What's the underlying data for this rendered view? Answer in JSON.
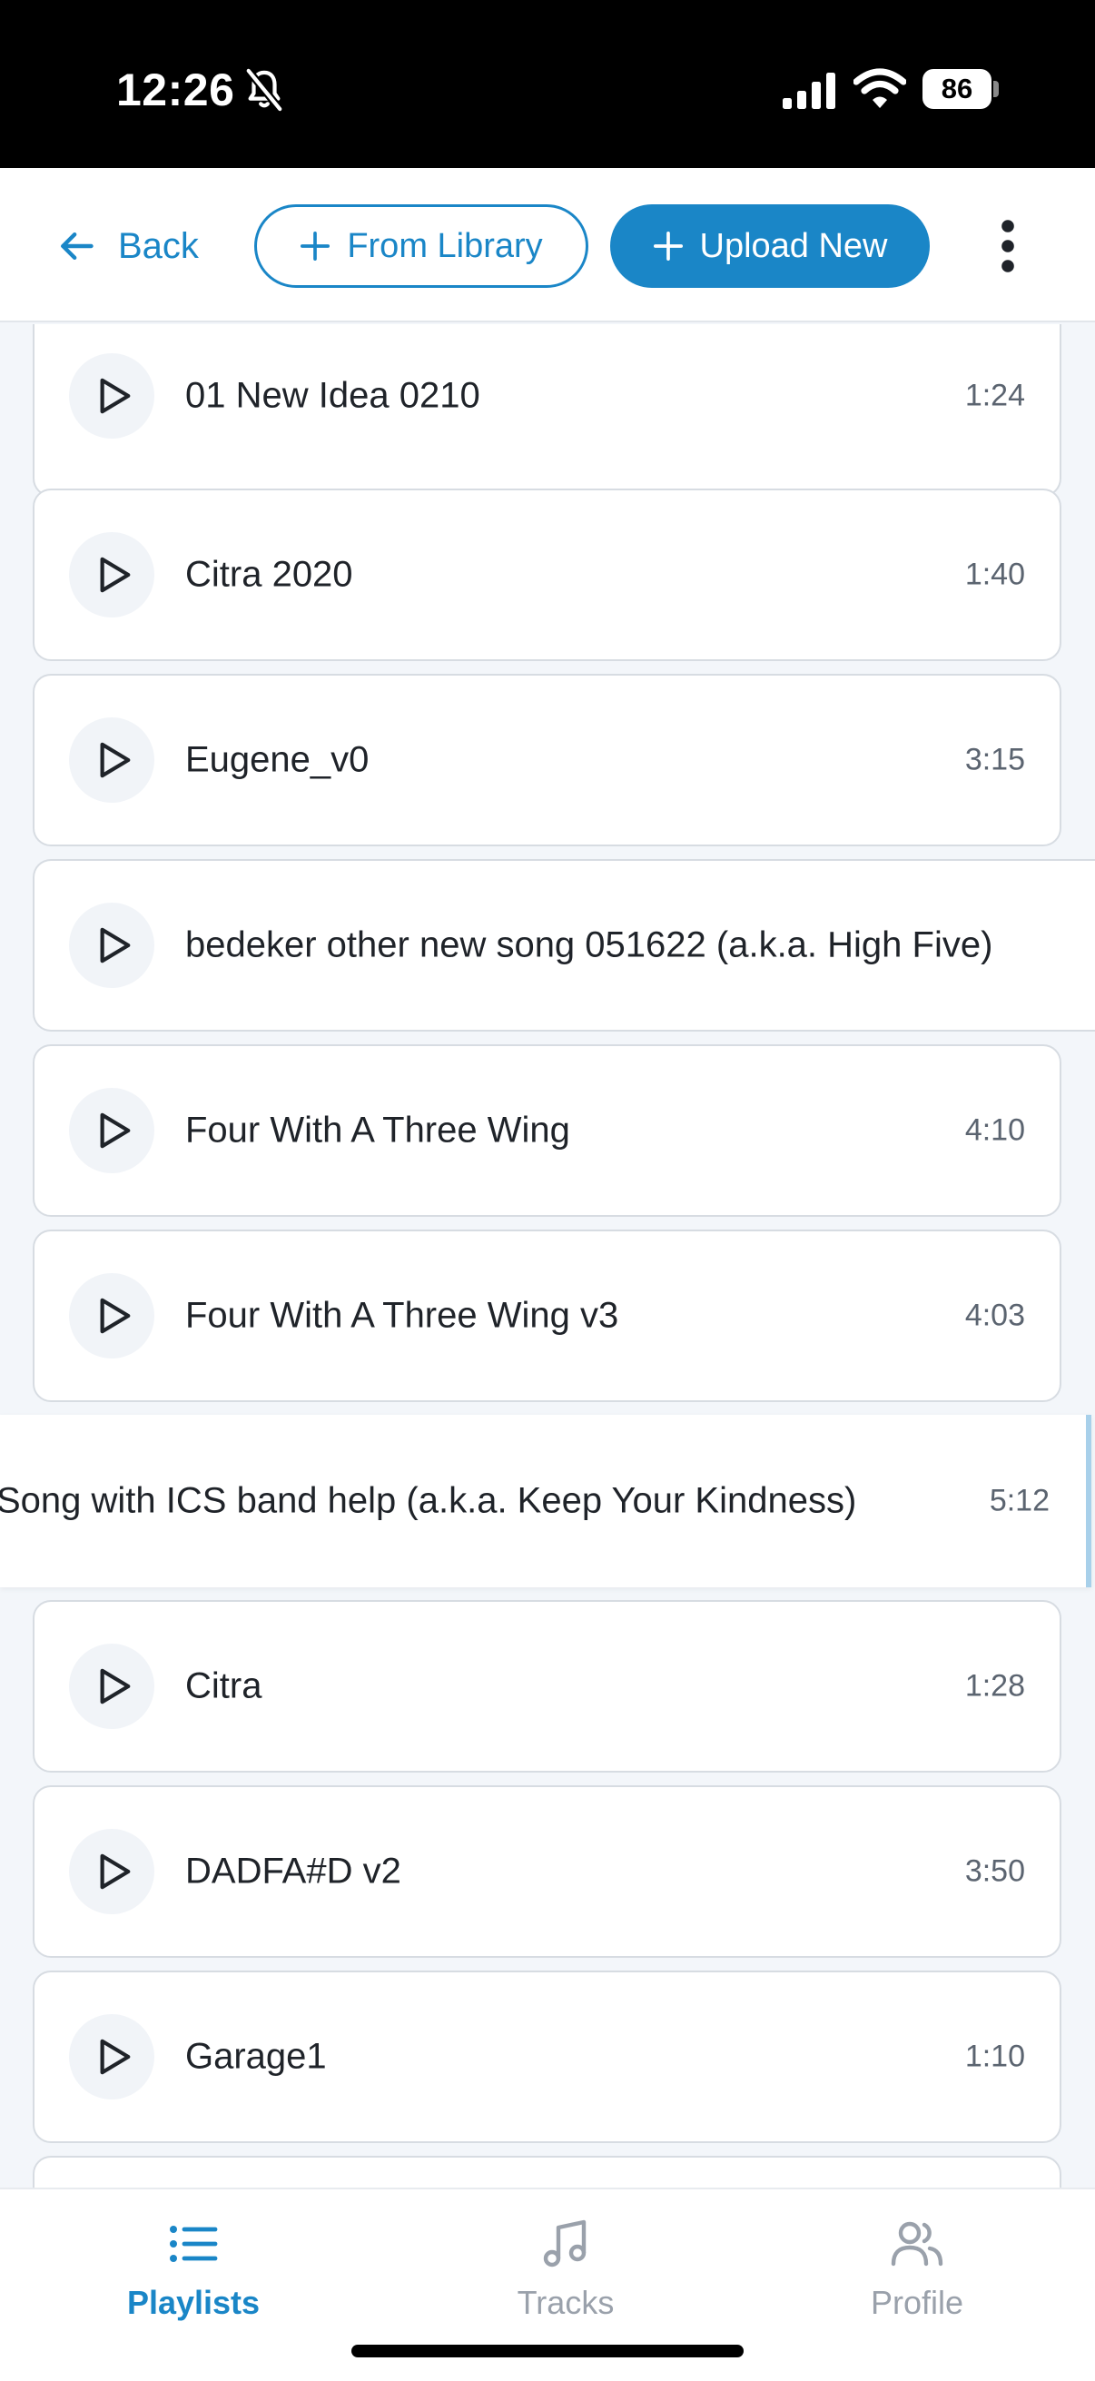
{
  "status_bar": {
    "time": "12:26",
    "battery": "86"
  },
  "header": {
    "back_label": "Back",
    "from_library_label": "From Library",
    "upload_new_label": "Upload New"
  },
  "tracks": [
    {
      "title": "01 New Idea 0210",
      "duration": "1:24"
    },
    {
      "title": "Citra 2020",
      "duration": "1:40"
    },
    {
      "title": "Eugene_v0",
      "duration": "3:15"
    },
    {
      "title": "bedeker other new song 051622 (a.k.a. High Five)",
      "duration": ""
    },
    {
      "title": "Four With A Three Wing",
      "duration": "4:10"
    },
    {
      "title": "Four With A Three Wing v3",
      "duration": "4:03"
    },
    {
      "title": "Song with ICS band help (a.k.a. Keep Your Kindness)",
      "duration": "5:12"
    },
    {
      "title": "Citra",
      "duration": "1:28"
    },
    {
      "title": "DADFA#D v2",
      "duration": "3:50"
    },
    {
      "title": "Garage1",
      "duration": "1:10"
    }
  ],
  "tab_bar": {
    "playlists_label": "Playlists",
    "tracks_label": "Tracks",
    "profile_label": "Profile"
  },
  "colors": {
    "accent": "#1a86c7",
    "background": "#f3f6fa",
    "card_border": "#d7dce2"
  },
  "icons": [
    "bell-slash-icon",
    "signal-icon",
    "wifi-icon",
    "battery-icon",
    "arrow-left-icon",
    "plus-icon",
    "more-vertical-icon",
    "play-icon",
    "list-icon",
    "music-note-icon",
    "users-icon"
  ]
}
